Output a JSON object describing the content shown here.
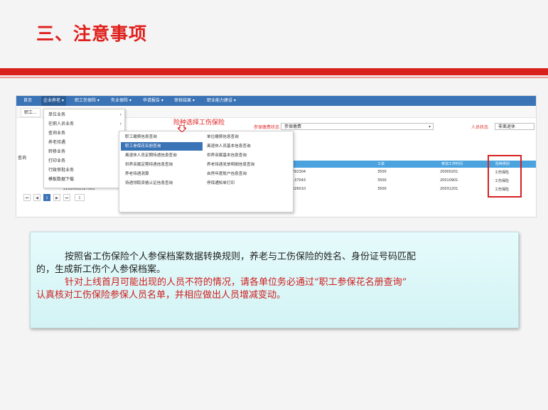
{
  "slide": {
    "title": "三、注意事项"
  },
  "screenshot": {
    "nav": [
      "首页",
      "企业养老 ▾",
      "职工伤保险 ▾",
      "失业保险 ▾",
      "申请报告 ▾",
      "审核结果 ▾",
      "职业能力建设 ▾"
    ],
    "tab_label": "职工…",
    "filters": {
      "insurance_status_label": "参保缴费状态",
      "insurance_status_value": "参保缴费",
      "person_status_label": "人员状态",
      "person_status_value": "非离退休"
    },
    "annotation": "险种选择工伤保险",
    "query_label": "查询",
    "menu_level1": [
      "单位业务",
      "在职人员业务",
      "查询业务",
      "养老待遇",
      "转移业务",
      "打印业务",
      "行政审批业务",
      "模板数据下载"
    ],
    "menu_level2_left": [
      "职工缴费信息查询",
      "职工参保花名册查询",
      "离退休人员定期待遇信息查询",
      "供养亲属定期待遇信息查询",
      "养老待遇测算",
      "待遇领取资格认证信息查询"
    ],
    "menu_level2_right": [
      "单位缴费信息查询",
      "离退休人员基本信息查询",
      "供养亲属基本信息查询",
      "养老待遇发放明细信息查询",
      "自然年度账户信息查询",
      "停保通知单打印"
    ],
    "grid_headers": [
      "工资",
      "参加工作时间",
      "险种类别"
    ],
    "grid_rows": [
      {
        "id": "292304",
        "wage": "3500",
        "date": "20000201",
        "type": "工伤保险"
      },
      {
        "id": "137043",
        "wage": "3500",
        "date": "20010901",
        "type": "工伤保险"
      },
      {
        "id": "026010",
        "wage": "3500",
        "date": "20031201",
        "type": "工伤保险"
      }
    ],
    "extra_row_id": "21020002527061",
    "pager": [
      "⏮",
      "◀",
      "1",
      "▶",
      "⏭",
      "1"
    ]
  },
  "note": {
    "line1": "按照省工伤保险个人参保档案数据转换规则，养老与工伤保险的姓名、身份证号码匹配",
    "line2": "的，生成新工伤个人参保档案。",
    "line3": "针对上线首月可能出现的人员不符的情况，请各单位务必通过“职工参保花名册查询”",
    "line4": "认真核对工伤保险参保人员名单，并相应做出人员增减变动。"
  },
  "colors": {
    "accent_red": "#d91f1b",
    "nav_blue": "#3a73b6",
    "grid_blue": "#4aa3df"
  }
}
